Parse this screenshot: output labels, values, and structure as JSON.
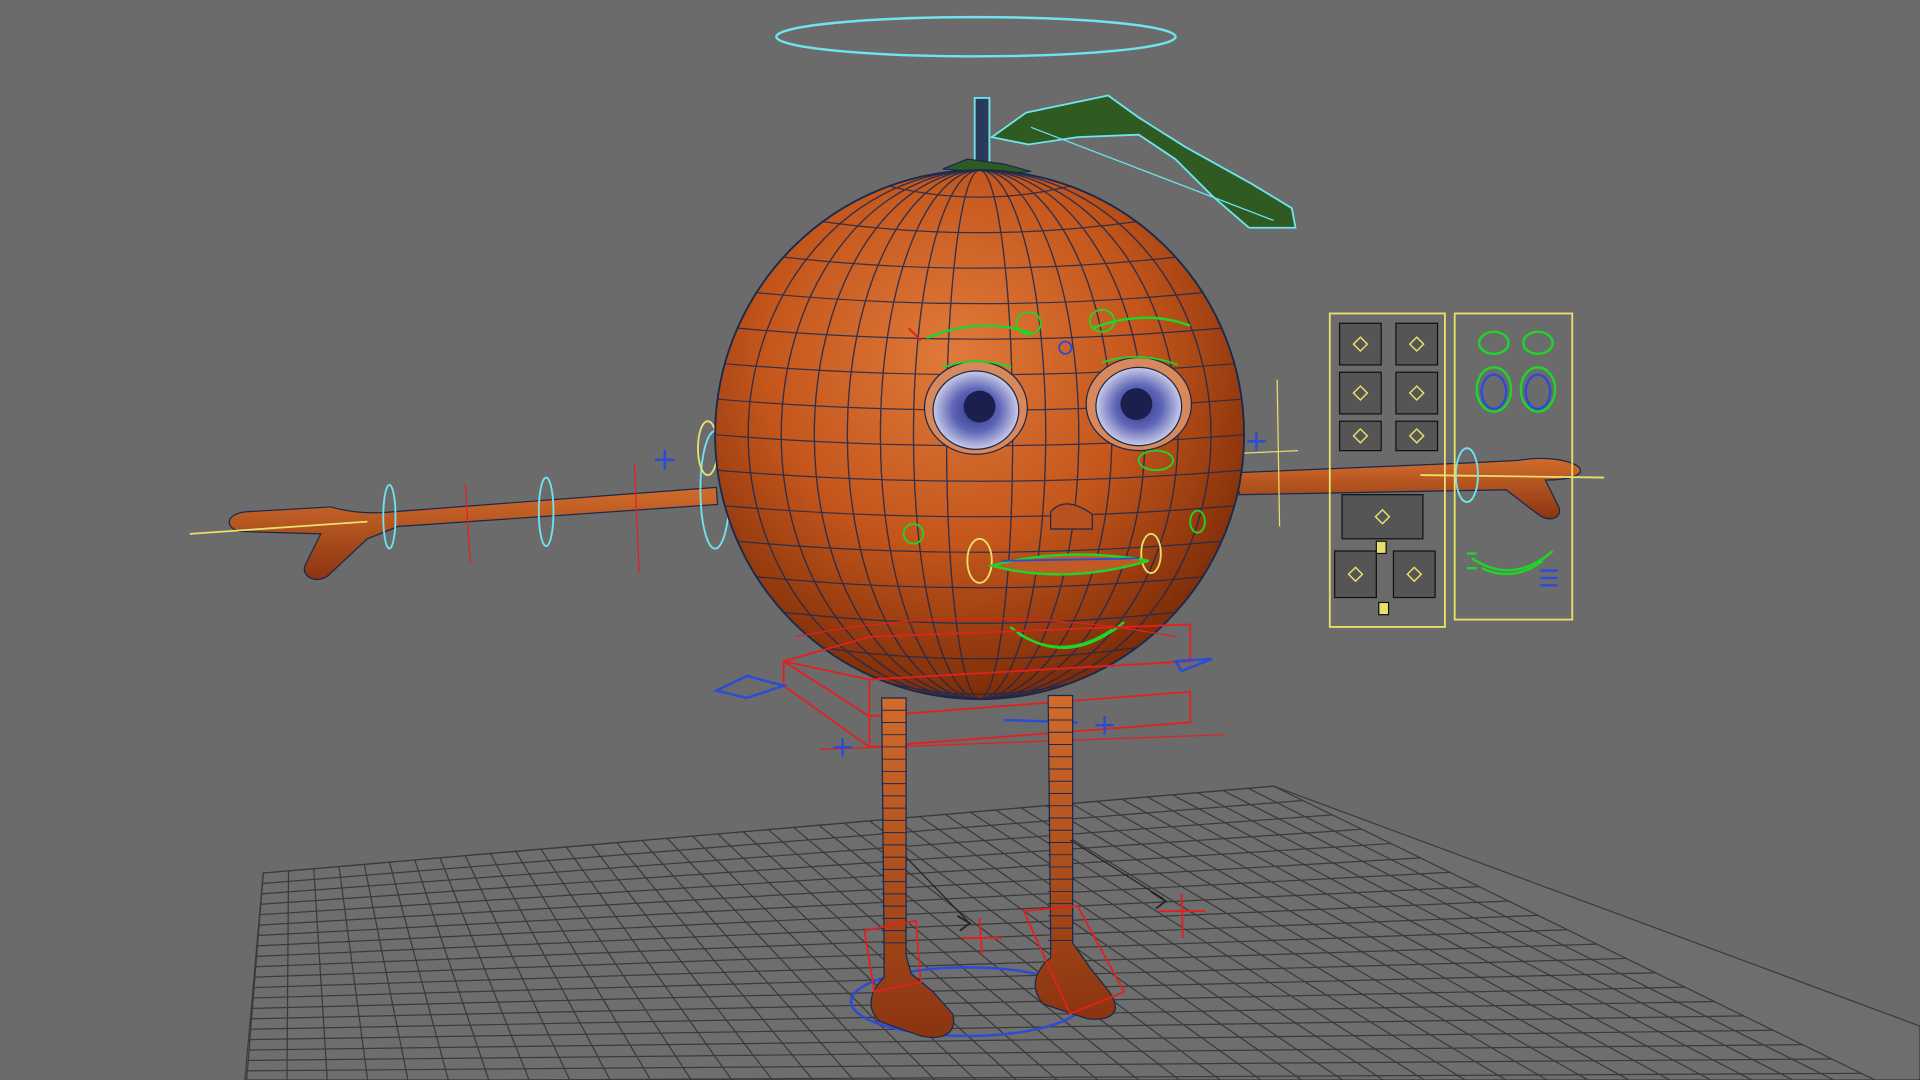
{
  "viewport": {
    "background": "#6b6b6b",
    "icon": "3d-viewport"
  },
  "scene": {
    "character": "orange-character-rig",
    "colors": {
      "skin": "#c95a1c",
      "skin_dark": "#7a2a0a",
      "wire": "#17294e",
      "leaf": "#2f5b22",
      "ctrl_red": "#e32020",
      "ctrl_blue": "#2c4bd6",
      "ctrl_green": "#22d42a",
      "ctrl_yellow": "#e8e06a",
      "ctrl_cyan": "#6fe3f0",
      "grid": "#3a3a3a"
    }
  }
}
